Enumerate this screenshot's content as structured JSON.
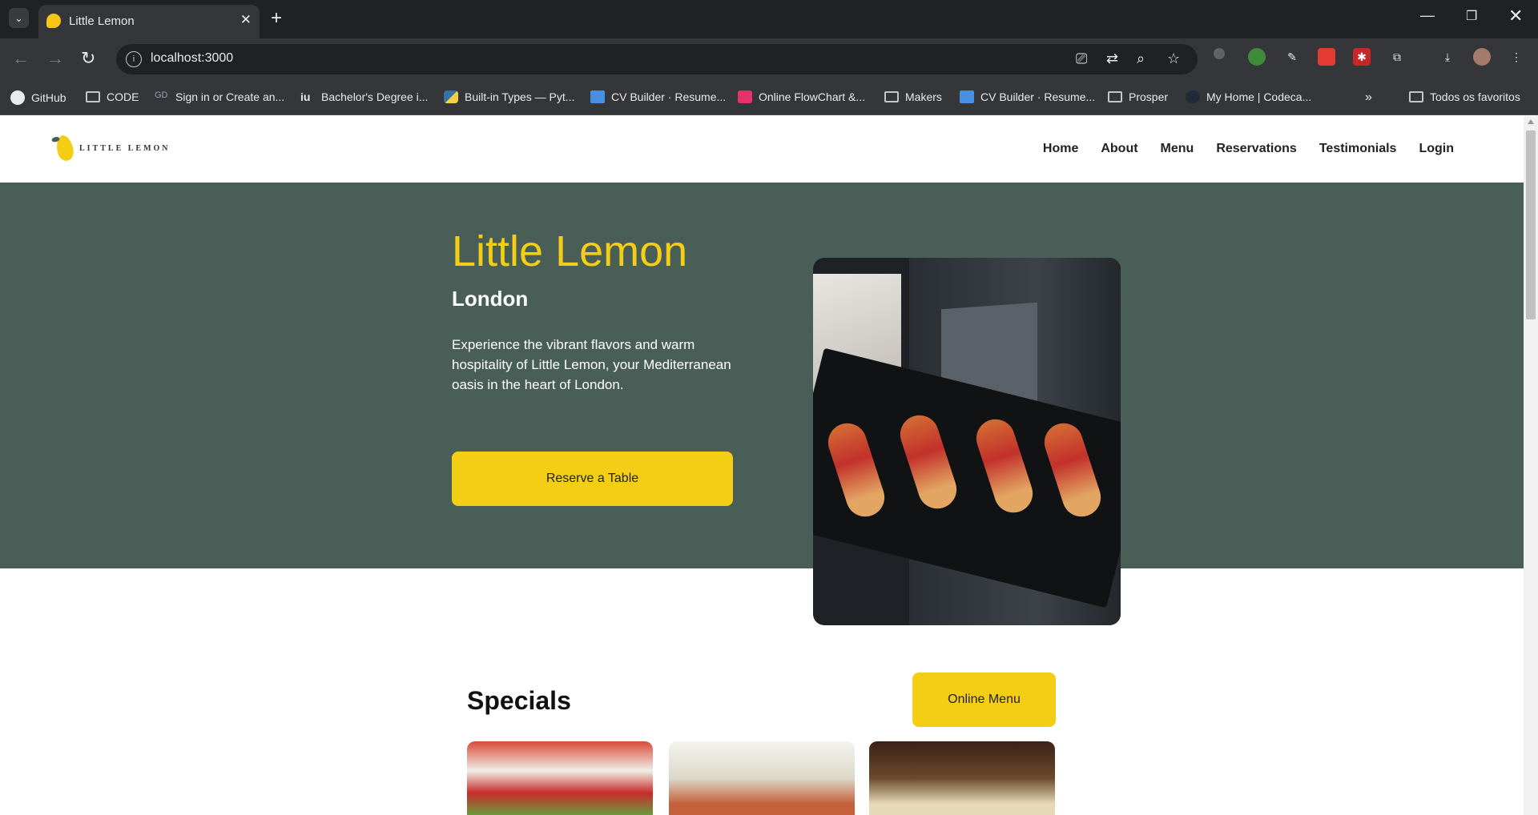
{
  "browser": {
    "tab_title": "Little Lemon",
    "url": "localhost:3000",
    "bookmarks": [
      {
        "label": "GitHub",
        "icon": "github-icon"
      },
      {
        "label": "CODE",
        "icon": "folder-icon"
      },
      {
        "label": "Sign in or Create an...",
        "icon": "link-icon"
      },
      {
        "label": "Bachelor's Degree i...",
        "icon": "iu-icon"
      },
      {
        "label": "Built-in Types — Pyt...",
        "icon": "python-icon"
      },
      {
        "label": "CV Builder · Resume...",
        "icon": "cv-icon"
      },
      {
        "label": "Online FlowChart &...",
        "icon": "flowchart-icon"
      },
      {
        "label": "Makers",
        "icon": "folder-icon"
      },
      {
        "label": "CV Builder · Resume...",
        "icon": "cv-icon"
      },
      {
        "label": "Prosper",
        "icon": "folder-icon"
      },
      {
        "label": "My Home | Codeca...",
        "icon": "codecademy-icon"
      }
    ],
    "all_bookmarks_label": "Todos os favoritos"
  },
  "site": {
    "logo_text": "LITTLE LEMON",
    "nav": [
      "Home",
      "About",
      "Menu",
      "Reservations",
      "Testimonials",
      "Login"
    ],
    "hero": {
      "title": "Little Lemon",
      "subtitle": "London",
      "description": "Experience the vibrant flavors and warm hospitality of Little Lemon, your Mediterranean oasis in the heart of London.",
      "cta_label": "Reserve a Table"
    },
    "specials": {
      "title": "Specials",
      "menu_button_label": "Online Menu"
    }
  },
  "colors": {
    "primary_green": "#495e57",
    "primary_yellow": "#f4ce14"
  }
}
